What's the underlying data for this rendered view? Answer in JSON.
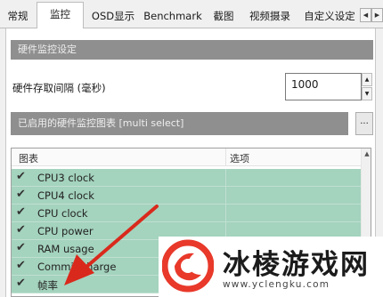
{
  "tabs": [
    "常规",
    "监控",
    "OSD显示",
    "Benchmark",
    "截图",
    "视频摄录",
    "自定义设定"
  ],
  "active_tab": "监控",
  "tab_scroll": {
    "left": "◀",
    "right": "▶"
  },
  "section_hw_monitor": "硬件监控设定",
  "poll_interval": {
    "label": "硬件存取间隔 (毫秒)",
    "value": "1000"
  },
  "spin": {
    "up": "▲",
    "down": "▼"
  },
  "section_enabled_graphs": "已启用的硬件监控图表 [multi select]",
  "dots_button": "...",
  "list": {
    "col_graph": "图表",
    "col_options": "选项",
    "check_glyph": "✔",
    "scroll_up": "▲",
    "rows": [
      "CPU3 clock",
      "CPU4 clock",
      "CPU clock",
      "CPU power",
      "RAM usage",
      "Commit charge",
      "帧率"
    ]
  },
  "watermark": {
    "title": "冰棱游戏网",
    "url": "www.yclengku.com"
  },
  "colors": {
    "row_highlight": "#a4d3be",
    "bar": "#8f8f8f",
    "arrow": "#d9291c",
    "logo": "#e8392a"
  }
}
